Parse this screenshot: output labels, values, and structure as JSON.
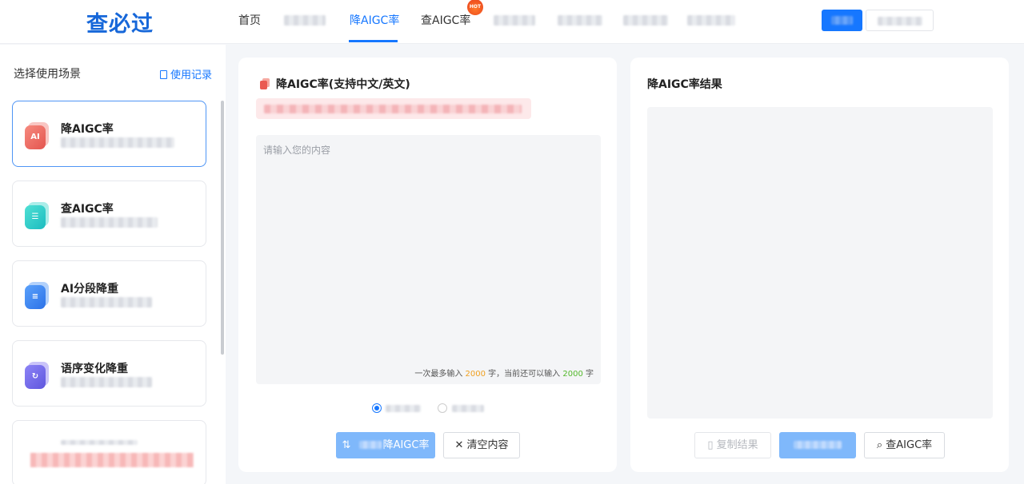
{
  "header": {
    "logo": "查必过",
    "nav": {
      "home": "首页",
      "reduce_aigc": "降AIGC率",
      "check_aigc": "查AIGC率",
      "hot_badge": "HOT"
    }
  },
  "sidebar": {
    "title": "选择使用场景",
    "record_link": "使用记录",
    "cards": [
      {
        "title": "降AIGC率",
        "icon": "ai-reduce-icon",
        "icon_glyph": "AI",
        "color": "#f0706a"
      },
      {
        "title": "查AIGC率",
        "icon": "ai-check-icon",
        "icon_glyph": "☰",
        "color": "#2ed1c7"
      },
      {
        "title": "AI分段降重",
        "icon": "segment-icon",
        "icon_glyph": "≡",
        "color": "#3f8bf5"
      },
      {
        "title": "语序变化降重",
        "icon": "reorder-icon",
        "icon_glyph": "↻",
        "color": "#7a6cf0"
      }
    ]
  },
  "editor": {
    "title": "降AIGC率(支持中文/英文)",
    "placeholder": "请输入您的内容",
    "counter_prefix": "一次最多输入",
    "counter_max": "2000",
    "counter_mid": "字，当前还可以输入",
    "counter_remaining": "2000",
    "counter_suffix": "字",
    "submit_label": "降AIGC率",
    "clear_label": "清空内容"
  },
  "result": {
    "title": "降AIGC率结果",
    "copy_label": "复制结果",
    "check_label": "查AIGC率"
  }
}
